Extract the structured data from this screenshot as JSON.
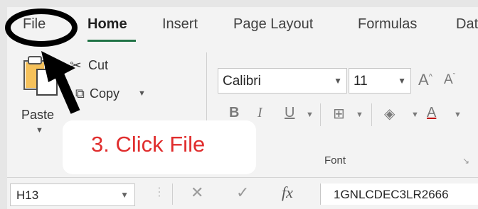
{
  "tabs": [
    "File",
    "Home",
    "Insert",
    "Page Layout",
    "Formulas",
    "Dat"
  ],
  "clipboard": {
    "paste_label": "Paste",
    "cut_label": "Cut",
    "copy_label": "Copy"
  },
  "font_group": {
    "font_name": "Calibri",
    "font_size": "11",
    "label": "Font"
  },
  "callout": {
    "text": "3. Click File"
  },
  "formula_bar": {
    "name_box": "H13",
    "formula": "1GNLCDEC3LR2666",
    "fx": "fx"
  },
  "colors": {
    "accent": "#217346",
    "callout_text": "#e02d2d",
    "annotation": "#000000"
  }
}
